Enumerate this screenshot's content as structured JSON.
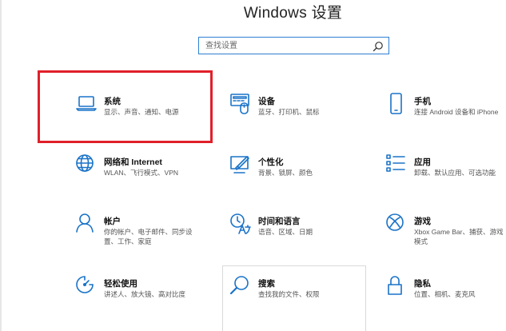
{
  "window": {
    "title": "Windows 设置"
  },
  "search": {
    "placeholder": "查找设置"
  },
  "tiles": [
    {
      "name": "系统",
      "desc": "显示、声音、通知、电源",
      "icon": "laptop-icon"
    },
    {
      "name": "设备",
      "desc": "蓝牙、打印机、鼠标",
      "icon": "devices-icon"
    },
    {
      "name": "手机",
      "desc": "连接 Android 设备和 iPhone",
      "icon": "phone-icon"
    },
    {
      "name": "网络和 Internet",
      "desc": "WLAN、飞行模式、VPN",
      "icon": "globe-icon"
    },
    {
      "name": "个性化",
      "desc": "背景、锁屏、颜色",
      "icon": "paint-icon"
    },
    {
      "name": "应用",
      "desc": "卸载、默认应用、可选功能",
      "icon": "apps-list-icon"
    },
    {
      "name": "帐户",
      "desc": "你的帐户、电子邮件、同步设置、工作、家庭",
      "icon": "person-icon"
    },
    {
      "name": "时间和语言",
      "desc": "语音、区域、日期",
      "icon": "time-language-icon"
    },
    {
      "name": "游戏",
      "desc": "Xbox Game Bar、捕获、游戏模式",
      "icon": "xbox-icon"
    },
    {
      "name": "轻松使用",
      "desc": "讲述人、放大镜、高对比度",
      "icon": "ease-of-access-icon"
    },
    {
      "name": "搜索",
      "desc": "查找我的文件、权限",
      "icon": "search-icon"
    },
    {
      "name": "隐私",
      "desc": "位置、相机、麦克风",
      "icon": "lock-icon"
    }
  ],
  "colors": {
    "accent": "#1a73c8",
    "highlight": "#e0202a"
  }
}
